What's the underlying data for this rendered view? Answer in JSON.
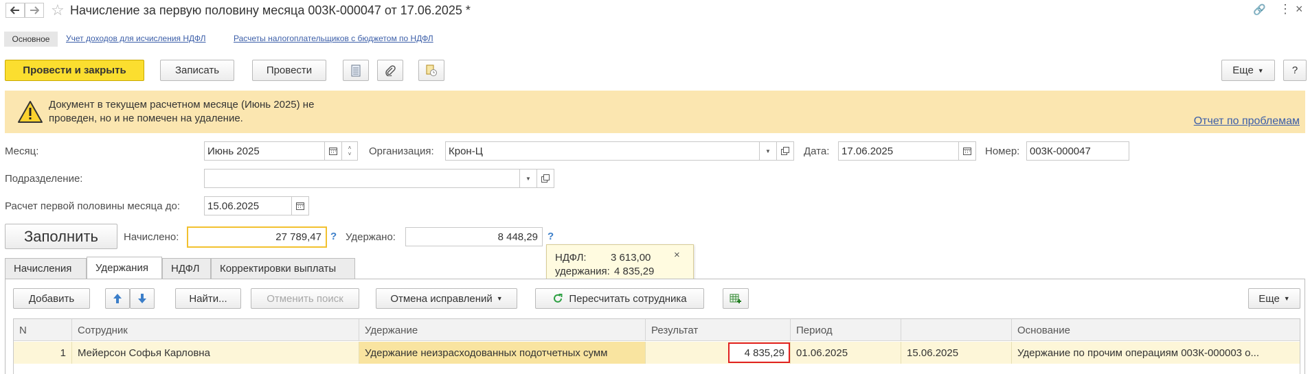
{
  "window": {
    "title": "Начисление за первую половину месяца 003К-000047 от 17.06.2025 *"
  },
  "nav_tabs": {
    "main": "Основное",
    "income_link": "Учет доходов для исчисления НДФЛ",
    "budget_link": "Расчеты налогоплательщиков с бюджетом по НДФЛ"
  },
  "toolbar": {
    "post_close": "Провести и закрыть",
    "save": "Записать",
    "post": "Провести",
    "more": "Еще",
    "help": "?"
  },
  "warning": {
    "text": "Документ в текущем расчетном месяце (Июнь 2025) не проведен, но и не помечен на удаление.",
    "report_link": "Отчет по проблемам"
  },
  "form": {
    "month_label": "Месяц:",
    "month_value": "Июнь 2025",
    "org_label": "Организация:",
    "org_value": "Крон-Ц",
    "date_label": "Дата:",
    "date_value": "17.06.2025",
    "number_label": "Номер:",
    "number_value": "003К-000047",
    "division_label": "Подразделение:",
    "division_value": "",
    "calc_until_label": "Расчет первой половины месяца до:",
    "calc_until_value": "15.06.2025",
    "fill_button": "Заполнить",
    "accrued_label": "Начислено:",
    "accrued_value": "27 789,47",
    "withheld_label": "Удержано:",
    "withheld_value": "8 448,29",
    "help_mark": "?"
  },
  "tooltip": {
    "ndfl_label": "НДФЛ:",
    "ndfl_value": "3 613,00",
    "deductions_label": "удержания:",
    "deductions_value": "4 835,29",
    "close": "×"
  },
  "tabs": [
    {
      "label": "Начисления"
    },
    {
      "label": "Удержания"
    },
    {
      "label": "НДФЛ"
    },
    {
      "label": "Корректировки выплаты"
    }
  ],
  "table_toolbar": {
    "add": "Добавить",
    "find": "Найти...",
    "cancel_search": "Отменить поиск",
    "cancel_corrections": "Отмена исправлений",
    "recalc_employee": "Пересчитать сотрудника",
    "more": "Еще"
  },
  "table": {
    "columns": [
      "N",
      "Сотрудник",
      "Удержание",
      "Результат",
      "Период",
      "",
      "Основание"
    ],
    "rows": [
      [
        "1",
        "Мейерсон Софья Карловна",
        "Удержание неизрасходованных подотчетных сумм",
        "4 835,29",
        "01.06.2025",
        "15.06.2025",
        "Удержание по прочим операциям 003К-000003 о..."
      ]
    ]
  },
  "colors": {
    "accent_yellow": "#fbde2f",
    "warning_bg": "#fbe6b0",
    "link_blue": "#3b5ea8",
    "highlight_red": "#e02020",
    "row_bg": "#fdf6d8"
  }
}
